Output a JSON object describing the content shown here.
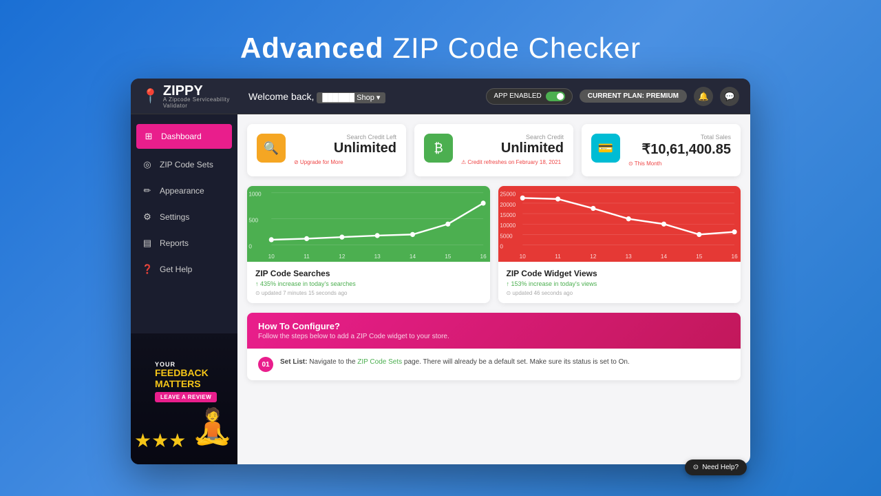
{
  "page": {
    "title_bold": "Advanced",
    "title_rest": " ZIP Code Checker"
  },
  "header": {
    "logo_text": "ZIPPY",
    "logo_sub": "A Zipcode Serviceability Validator",
    "welcome": "Welcome back,",
    "app_enabled_label": "APP ENABLED",
    "plan_label": "CURRENT PLAN: PREMIUM"
  },
  "nav": {
    "items": [
      {
        "label": "Dashboard",
        "icon": "⊞",
        "active": true
      },
      {
        "label": "ZIP Code Sets",
        "icon": "◎",
        "active": false
      },
      {
        "label": "Appearance",
        "icon": "✏",
        "active": false
      },
      {
        "label": "Settings",
        "icon": "⚙",
        "active": false
      },
      {
        "label": "Reports",
        "icon": "▤",
        "active": false
      },
      {
        "label": "Get Help",
        "icon": "❓",
        "active": false
      }
    ]
  },
  "feedback": {
    "your": "YOUR",
    "feedback": "FEEDBACK",
    "matters": "MATTERS",
    "cta": "LEAVE A REVIEW"
  },
  "stats": [
    {
      "icon_type": "orange",
      "icon": "🔍",
      "label": "Search Credit Left",
      "value": "Unlimited",
      "sub": "⊘ Upgrade for More",
      "sub_type": "red"
    },
    {
      "icon_type": "green",
      "icon": "₿",
      "label": "Search Credit",
      "value": "Unlimited",
      "sub": "⚠ Credit refreshes on February 18, 2021",
      "sub_type": "warn"
    },
    {
      "icon_type": "teal",
      "icon": "💳",
      "label": "Total Sales",
      "value": "₹10,61,400.85",
      "sub": "⊙ This Month",
      "sub_type": "gray"
    }
  ],
  "charts": [
    {
      "bg": "green",
      "title": "ZIP Code Searches",
      "stat": "↑ 435% increase in today's searches",
      "update": "updated 7 minutes 15 seconds ago",
      "y_labels": [
        "1000",
        "500",
        "0"
      ],
      "x_labels": [
        "10",
        "11",
        "12",
        "13",
        "14",
        "15",
        "16"
      ],
      "points": [
        [
          0,
          90
        ],
        [
          1,
          88
        ],
        [
          2,
          85
        ],
        [
          3,
          82
        ],
        [
          4,
          80
        ],
        [
          5,
          60
        ],
        [
          6,
          20
        ]
      ]
    },
    {
      "bg": "red",
      "title": "ZIP Code Widget Views",
      "stat": "↑ 153% increase in today's views",
      "update": "updated 46 seconds ago",
      "y_labels": [
        "25000",
        "20000",
        "15000",
        "10000",
        "5000",
        "0"
      ],
      "x_labels": [
        "10",
        "11",
        "12",
        "13",
        "14",
        "15",
        "16"
      ],
      "points": [
        [
          0,
          10
        ],
        [
          1,
          12
        ],
        [
          2,
          30
        ],
        [
          3,
          50
        ],
        [
          4,
          60
        ],
        [
          5,
          80
        ],
        [
          6,
          75
        ]
      ]
    }
  ],
  "configure": {
    "title": "How To Configure?",
    "subtitle": "Follow the steps below to add a ZIP Code widget to your store.",
    "step1_num": "01",
    "step1_bold": "Set List:",
    "step1_text": " Navigate to the ",
    "step1_link": "ZIP Code Sets",
    "step1_rest": " page. There will already be a default set. Make sure its status is set to On."
  },
  "need_help": {
    "label": "Need Help?"
  }
}
